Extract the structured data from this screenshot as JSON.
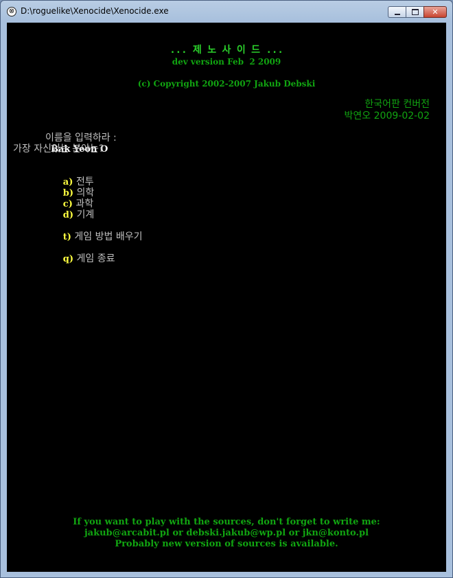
{
  "window": {
    "title": "D:\\roguelike\\Xenocide\\Xenocide.exe",
    "icon": "xenocide-app-icon",
    "buttons": {
      "minimize": "minimize-icon",
      "maximize": "maximize-icon",
      "close_label": "✕"
    }
  },
  "header": {
    "game_title": "... 제 노 사 이 드 ...",
    "version": "dev version Feb  2 2009",
    "copyright": "(c) Copyright 2002-2007 Jakub Debski",
    "korean_edition": "한국어판 컨버전",
    "translator": "박연오 2009-02-02"
  },
  "prompt": {
    "name_label": "이름을 입력하라 :",
    "name_value": "Bak Yeon O",
    "question": "가장 자신있는 분야는?"
  },
  "menu": {
    "items": [
      {
        "key": "a)",
        "label": " 전투"
      },
      {
        "key": "b)",
        "label": " 의학"
      },
      {
        "key": "c)",
        "label": " 과학"
      },
      {
        "key": "d)",
        "label": " 기계"
      },
      {
        "key": "t)",
        "label": " 게임 방법 배우기"
      },
      {
        "key": "q)",
        "label": " 게임 종료"
      }
    ]
  },
  "footer": {
    "line1": "If you want to play with the sources, don't forget to write me:",
    "line2": "jakub@arcabit.pl or debski.jakub@wp.pl or jkn@konto.pl",
    "line3": "Probably new version of sources is available."
  },
  "colors": {
    "background": "#000000",
    "green_text": "#11a511",
    "bright_green_title": "#2bd12b",
    "gray_text": "#c0c0c0",
    "menu_key": "#ffff40",
    "name_value": "#ffffff"
  }
}
